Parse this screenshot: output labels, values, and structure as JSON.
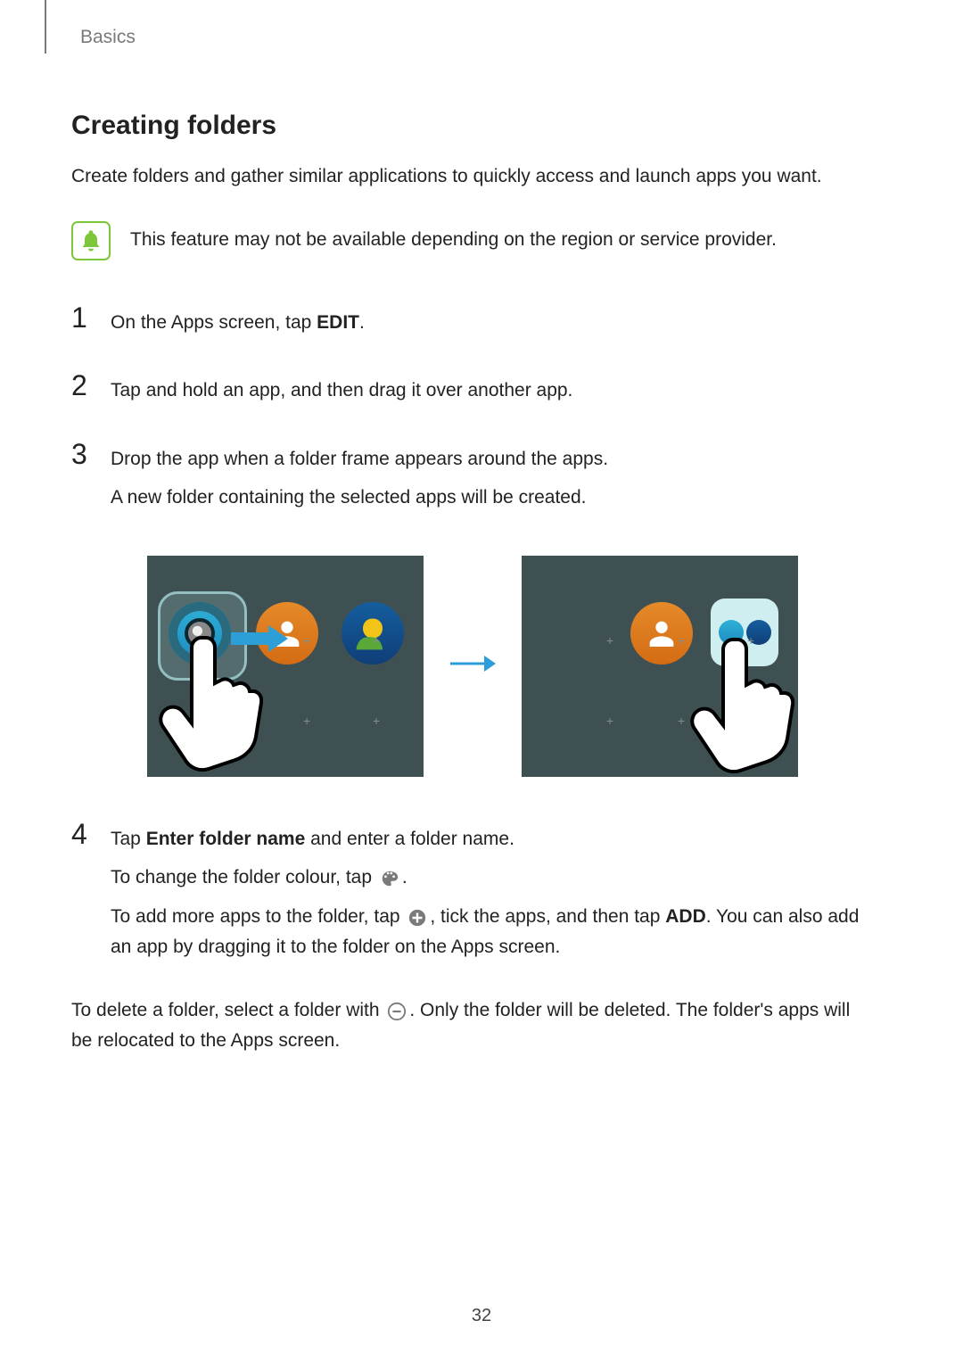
{
  "breadcrumb": "Basics",
  "title": "Creating folders",
  "intro": "Create folders and gather similar applications to quickly access and launch apps you want.",
  "note": "This feature may not be available depending on the region or service provider.",
  "steps": {
    "s1": {
      "num": "1",
      "prefix": "On the Apps screen, tap ",
      "bold": "EDIT",
      "suffix": "."
    },
    "s2": {
      "num": "2",
      "text": "Tap and hold an app, and then drag it over another app."
    },
    "s3": {
      "num": "3",
      "line1": "Drop the app when a folder frame appears around the apps.",
      "line2": "A new folder containing the selected apps will be created."
    },
    "s4": {
      "num": "4",
      "l1_pre": "Tap ",
      "l1_bold": "Enter folder name",
      "l1_post": " and enter a folder name.",
      "l2_pre": "To change the folder colour, tap ",
      "l2_post": ".",
      "l3_pre": "To add more apps to the folder, tap ",
      "l3_mid": ", tick the apps, and then tap ",
      "l3_bold": "ADD",
      "l3_post": ". You can also add an app by dragging it to the folder on the Apps screen."
    }
  },
  "closing": {
    "pre": "To delete a folder, select a folder with ",
    "post": ". Only the folder will be deleted. The folder's apps will be relocated to the Apps screen."
  },
  "page_number": "32"
}
